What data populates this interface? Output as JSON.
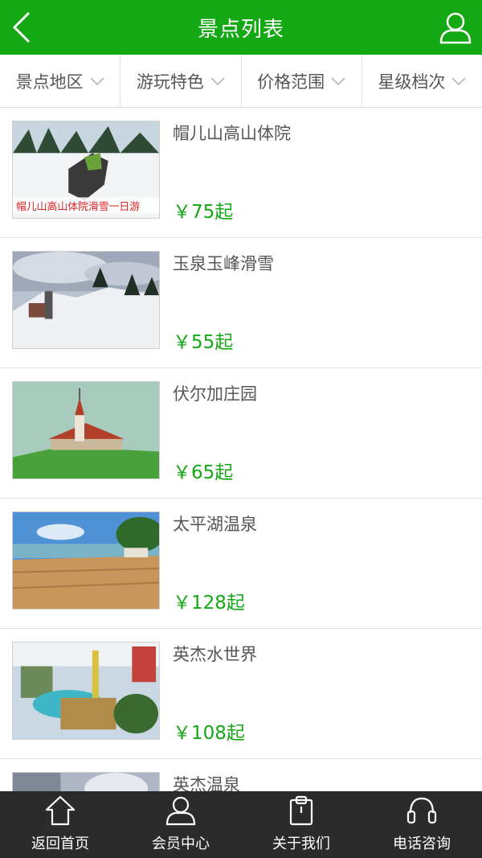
{
  "header": {
    "title": "景点列表",
    "back_icon": "chevron-left-icon",
    "user_icon": "user-icon"
  },
  "filters": [
    {
      "label": "景点地区"
    },
    {
      "label": "游玩特色"
    },
    {
      "label": "价格范围"
    },
    {
      "label": "星级档次"
    }
  ],
  "items": [
    {
      "name": "帽儿山高山体院",
      "price": "￥75起",
      "image_caption": "帽儿山高山体院滑雪一日游"
    },
    {
      "name": "玉泉玉峰滑雪",
      "price": "￥55起"
    },
    {
      "name": "伏尔加庄园",
      "price": "￥65起"
    },
    {
      "name": "太平湖温泉",
      "price": "￥128起"
    },
    {
      "name": "英杰水世界",
      "price": "￥108起"
    },
    {
      "name": "英杰温泉"
    }
  ],
  "bottom_nav": [
    {
      "label": "返回首页",
      "icon": "home-icon"
    },
    {
      "label": "会员中心",
      "icon": "user-icon"
    },
    {
      "label": "关于我们",
      "icon": "clipboard-icon"
    },
    {
      "label": "电话咨询",
      "icon": "headset-icon"
    }
  ],
  "colors": {
    "brand_green": "#14a814",
    "nav_bg": "#2b2b2b"
  }
}
